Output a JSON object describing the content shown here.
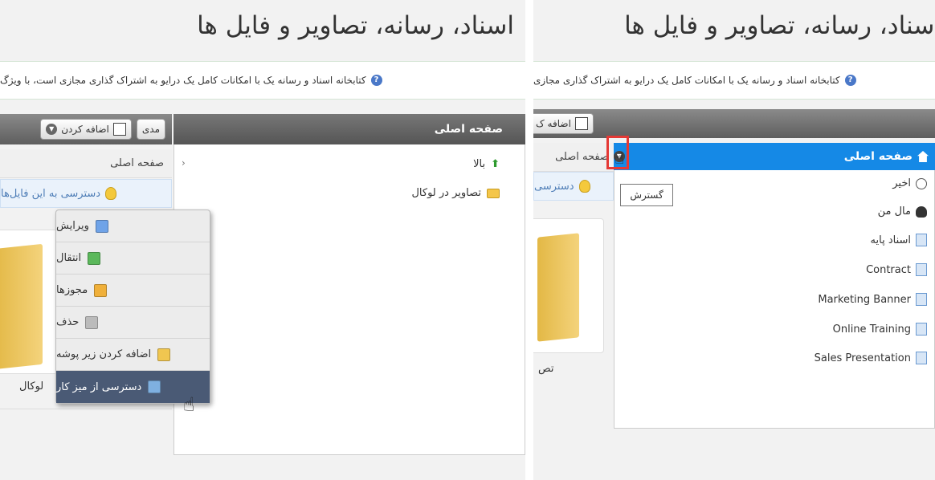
{
  "page_title": "اسناد، رسانه، تصاویر و فایل ها",
  "info_text": "کتابخانه اسناد و رسانه یک با امکانات کامل یک درایو به اشتراک گذاری مجازی است، با ویژگ",
  "info_text_right": "کتابخانه اسناد و رسانه یک با امکانات کامل یک درایو به اشتراک گذاری مجازی",
  "left": {
    "tree_header": "صفحه اصلی",
    "tree_items": [
      {
        "label": "بالا"
      },
      {
        "label": "تصاویر در لوکال"
      }
    ],
    "toolbar": {
      "add_label": "اضافه کردن",
      "manage_label": "مدی"
    },
    "breadcrumb": "صفحه اصلی",
    "tip": "دسترسی به این فایل‌ها",
    "card_label": "لوکال",
    "context_menu": [
      {
        "label": "ویرایش",
        "icon": "edit-icon",
        "color": "#6fa3e8"
      },
      {
        "label": "انتقال",
        "icon": "move-icon",
        "color": "#5bb85b"
      },
      {
        "label": "مجوزها",
        "icon": "permissions-icon",
        "color": "#f0b03a"
      },
      {
        "label": "حذف",
        "icon": "trash-icon",
        "color": "#bbbbbb"
      },
      {
        "label": "اضافه کردن زیر پوشه",
        "icon": "add-subfolder-icon",
        "color": "#f0c650"
      },
      {
        "label": "دسترسی از میز کار",
        "icon": "desktop-access-icon",
        "color": "#7fb0e0"
      }
    ]
  },
  "right": {
    "toolbar_add": "اضافه ک",
    "breadcrumb": "صفحه اصلی",
    "tip": "دسترسی",
    "selected_item": "صفحه اصلی",
    "tooltip": "گسترش",
    "card_label": "تص",
    "tree_items": [
      {
        "label": "اخیر",
        "icon": "clock-icon"
      },
      {
        "label": "مال من",
        "icon": "user-icon"
      },
      {
        "label": "اسناد پایه",
        "icon": "document-icon"
      },
      {
        "label": "Contract",
        "icon": "document-icon"
      },
      {
        "label": "Marketing Banner",
        "icon": "document-icon"
      },
      {
        "label": "Online Training",
        "icon": "document-icon"
      },
      {
        "label": "Sales Presentation",
        "icon": "document-icon"
      }
    ]
  },
  "colors": {
    "selected_blue": "#1589e6",
    "highlight_red": "#e53935",
    "toolbar_gray": "#666666"
  }
}
